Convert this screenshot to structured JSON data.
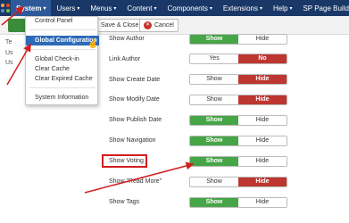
{
  "navbar": {
    "logo_icon": "joomla-logo-icon",
    "items": [
      {
        "label": "System",
        "active": true
      },
      {
        "label": "Users"
      },
      {
        "label": "Menus"
      },
      {
        "label": "Content"
      },
      {
        "label": "Components"
      },
      {
        "label": "Extensions"
      },
      {
        "label": "Help"
      },
      {
        "label": "SP Page Build"
      }
    ]
  },
  "toolbar": {
    "save_close": "Save & Close",
    "cancel": "Cancel",
    "cancel_icon": "cancel-icon"
  },
  "left_stub": [
    "Te",
    "Us",
    "Us"
  ],
  "dropdown": {
    "items": [
      "Control Panel",
      "Global Configuration",
      "Global Check-in",
      "Clear Cache",
      "Clear Expired Cache",
      "System Information"
    ],
    "highlighted": "Global Configuration"
  },
  "settings": [
    {
      "label": "Show Author",
      "options": [
        "Show",
        "Hide"
      ],
      "selected": "Show"
    },
    {
      "label": "Link Author",
      "options": [
        "Yes",
        "No"
      ],
      "selected": "No"
    },
    {
      "label": "Show Create Date",
      "options": [
        "Show",
        "Hide"
      ],
      "selected": "Hide"
    },
    {
      "label": "Show Modify Date",
      "options": [
        "Show",
        "Hide"
      ],
      "selected": "Hide"
    },
    {
      "label": "Show Publish Date",
      "options": [
        "Show",
        "Hide"
      ],
      "selected": "Show"
    },
    {
      "label": "Show Navigation",
      "options": [
        "Show",
        "Hide"
      ],
      "selected": "Show"
    },
    {
      "label": "Show Voting",
      "options": [
        "Show",
        "Hide"
      ],
      "selected": "Show",
      "highlighted": true
    },
    {
      "label": "Show \"Read More\"",
      "options": [
        "Show",
        "Hide"
      ],
      "selected": "Hide"
    },
    {
      "label": "Show Tags",
      "options": [
        "Show",
        "Hide"
      ],
      "selected": "Show"
    }
  ],
  "colors": {
    "navbar": "#1a3867",
    "green": "#46a546",
    "red": "#bd362f",
    "highlight_blue": "#2d6ab7",
    "annotation_red": "#d01d1d"
  }
}
